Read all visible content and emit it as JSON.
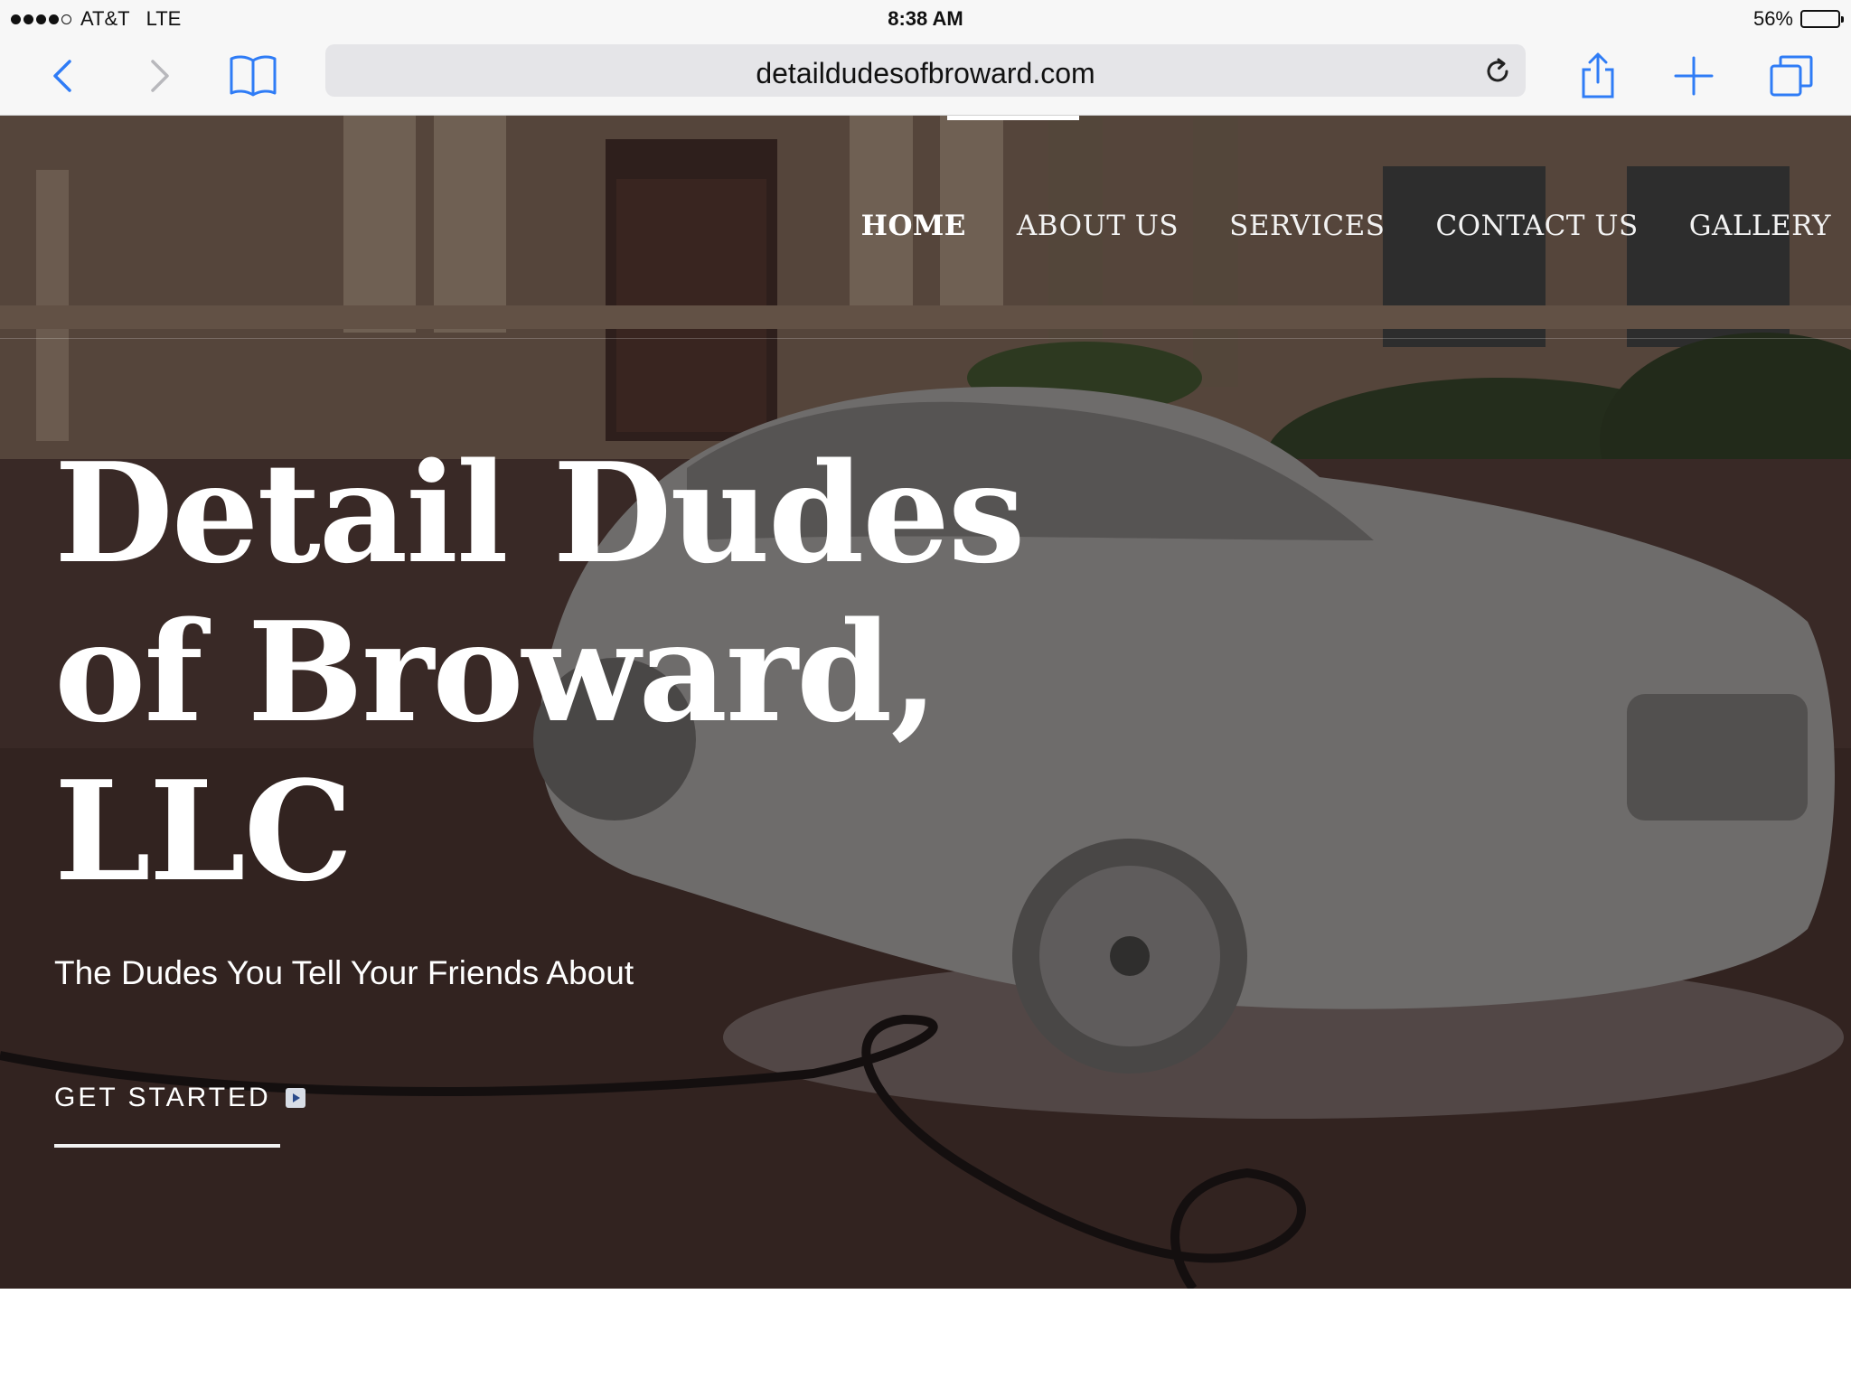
{
  "status_bar": {
    "carrier": "AT&T",
    "network": "LTE",
    "time": "8:38 AM",
    "battery_text": "56%",
    "battery_level": 0.56
  },
  "browser": {
    "url": "detaildudesofbroward.com",
    "accent_color": "#2f7cf6"
  },
  "nav": {
    "items": [
      {
        "label": "HOME",
        "active": true
      },
      {
        "label": "ABOUT US"
      },
      {
        "label": "SERVICES"
      },
      {
        "label": "CONTACT US"
      },
      {
        "label": "GALLERY"
      }
    ]
  },
  "hero": {
    "title_line1": "Detail Dudes",
    "title_line2": "of Broward,",
    "title_line3": "LLC",
    "tagline": "The Dudes You Tell Your Friends About",
    "cta_label": "GET STARTED"
  }
}
